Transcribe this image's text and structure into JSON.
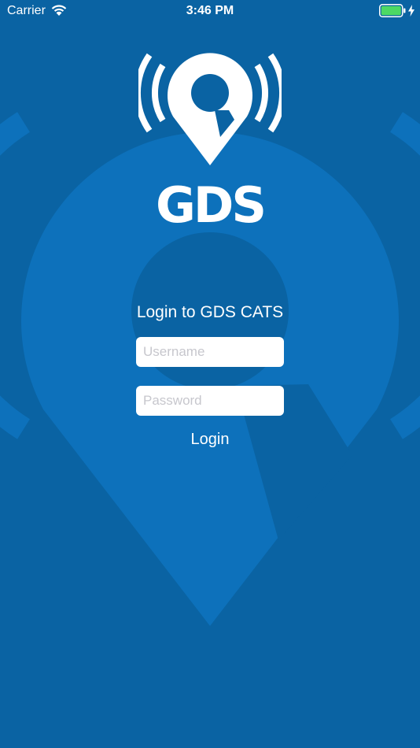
{
  "status_bar": {
    "carrier": "Carrier",
    "time": "3:46 PM",
    "battery_color": "#4cd964"
  },
  "icons": {
    "wifi": "wifi-icon",
    "battery": "battery-icon",
    "charging": "charging-bolt-icon",
    "logo": "location-pin-signal-icon"
  },
  "brand": {
    "name": "GDS"
  },
  "login": {
    "title": "Login to GDS CATS",
    "username_placeholder": "Username",
    "password_placeholder": "Password",
    "button_label": "Login"
  },
  "colors": {
    "background": "#0a63a3",
    "watermark": "#0d71bb"
  }
}
